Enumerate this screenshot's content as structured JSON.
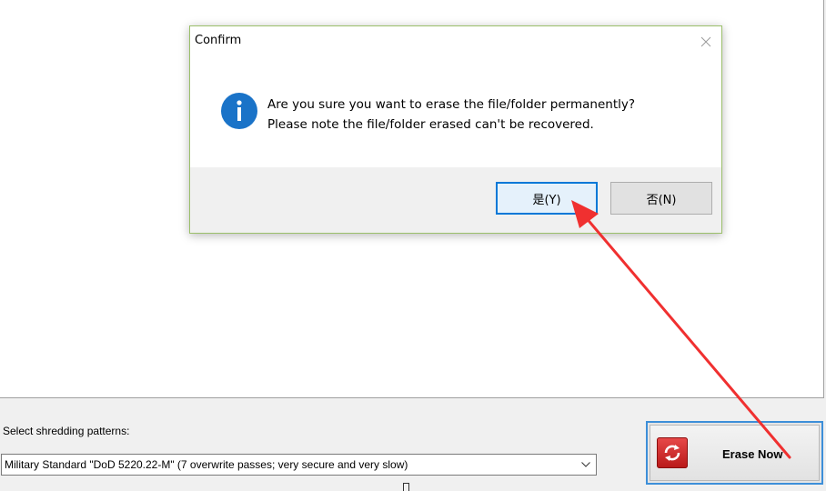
{
  "main": {
    "pattern_label": "Select shredding patterns:",
    "pattern_value": "Military Standard \"DoD 5220.22-M\" (7 overwrite passes; very secure and very slow)",
    "erase_button_label": "Erase Now"
  },
  "dialog": {
    "title": "Confirm",
    "message_line1": "Are you sure you want to erase the file/folder permanently?",
    "message_line2": "Please note the file/folder erased can't be recovered.",
    "yes_label": "是(Y)",
    "no_label": "否(N)"
  },
  "icons": {
    "close": "close-icon",
    "info": "info-icon",
    "dropdown": "chevron-down-icon",
    "erase": "shred-icon",
    "annotation": "red-arrow-annotation"
  },
  "colors": {
    "accent_blue": "#0078d7",
    "info_blue": "#1a73c8",
    "erase_border": "#3d8fd9",
    "erase_icon_red": "#d42a2a",
    "annotation_red": "#f03030",
    "dialog_border": "#9bbf6a"
  }
}
